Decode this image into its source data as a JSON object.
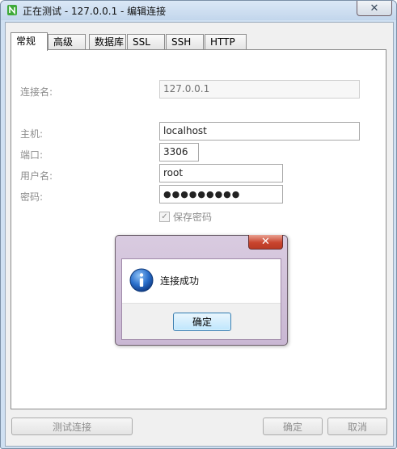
{
  "window": {
    "title": "正在测试 - 127.0.0.1 - 编辑连接",
    "close_glyph": "✕"
  },
  "tabs": [
    {
      "label": "常规",
      "active": true
    },
    {
      "label": "高级",
      "active": false
    },
    {
      "label": "数据库",
      "active": false
    },
    {
      "label": "SSL",
      "active": false
    },
    {
      "label": "SSH",
      "active": false
    },
    {
      "label": "HTTP",
      "active": false
    }
  ],
  "form": {
    "connection_name_label": "连接名:",
    "connection_name_value": "127.0.0.1",
    "host_label": "主机:",
    "host_value": "localhost",
    "port_label": "端口:",
    "port_value": "3306",
    "user_label": "用户名:",
    "user_value": "root",
    "password_label": "密码:",
    "password_value": "●●●●●●●●●",
    "save_password_label": "保存密码",
    "save_password_checked": true
  },
  "buttons": {
    "test": "测试连接",
    "ok": "确定",
    "cancel": "取消"
  },
  "dialog": {
    "message": "连接成功",
    "ok": "确定",
    "close_glyph": "✕"
  },
  "colors": {
    "accent": "#3c7fb1",
    "close_red": "#c9452e",
    "info_blue": "#1f5fb4"
  },
  "icons": {
    "title": "navicat-app-icon",
    "dialog": "info-icon"
  }
}
